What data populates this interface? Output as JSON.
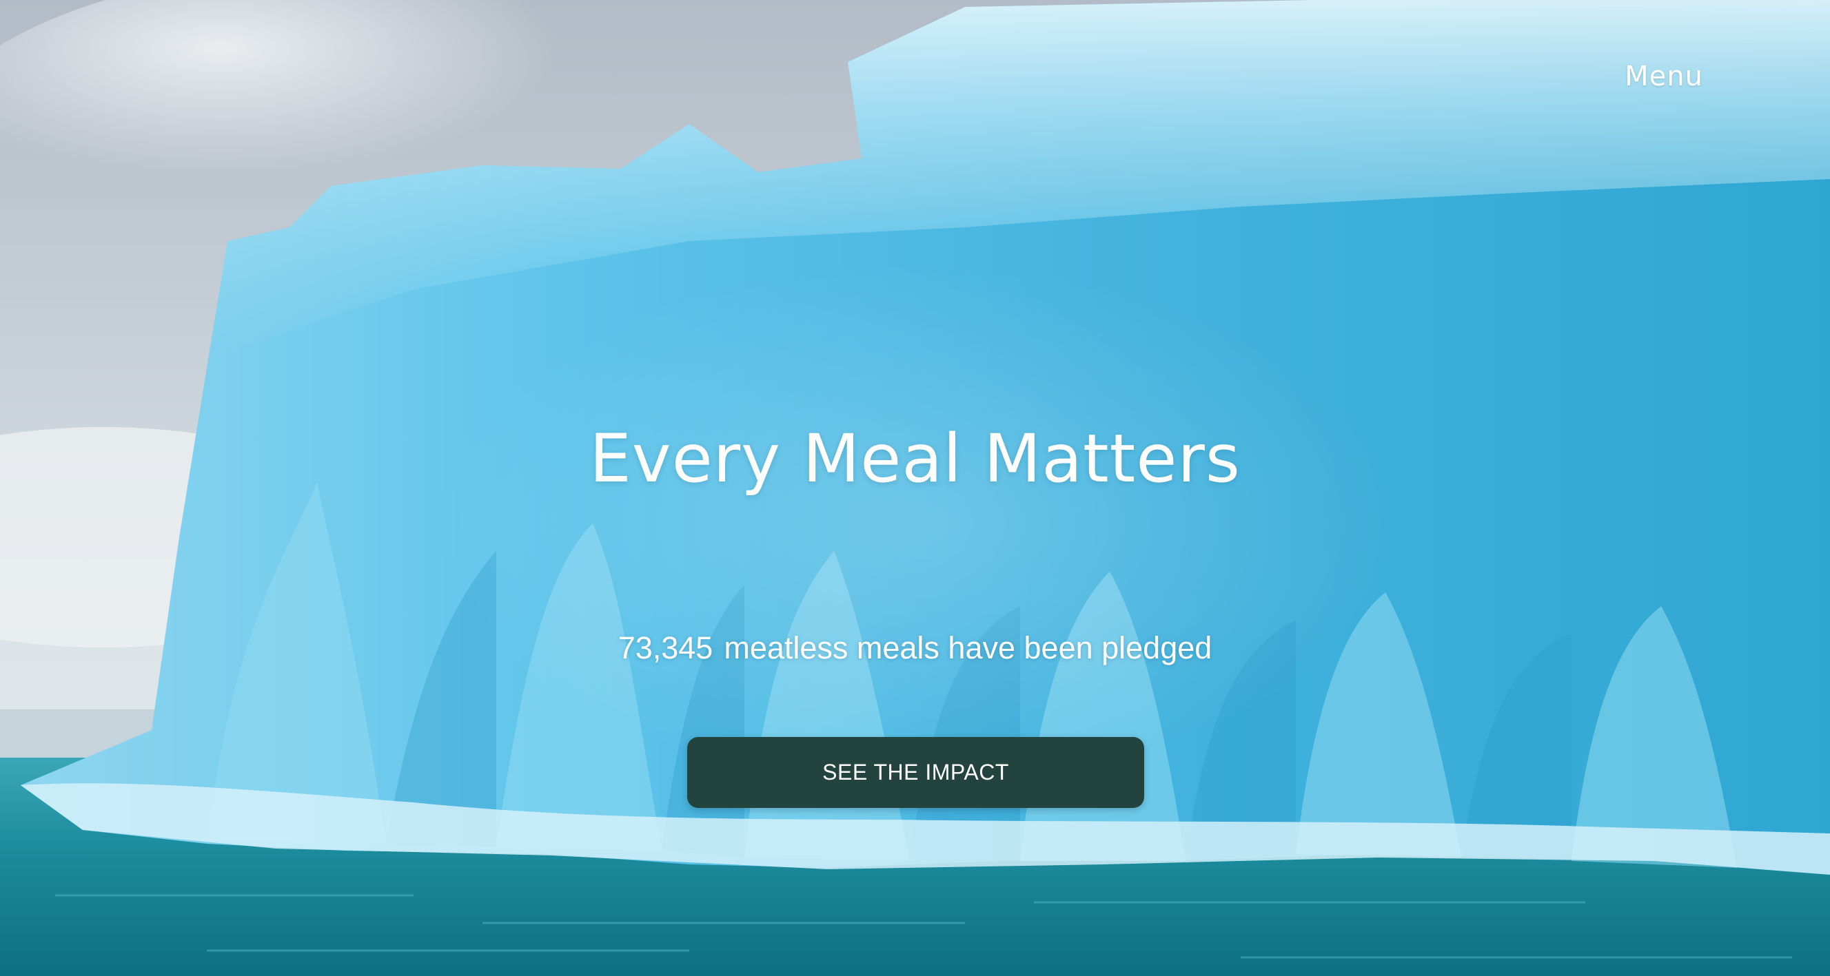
{
  "nav": {
    "menu_label": "Menu"
  },
  "hero": {
    "headline": "Every Meal Matters",
    "pledge_count": "73,345",
    "pledge_text": "meatless meals have been pledged",
    "cta_label": "SEE THE IMPACT",
    "background_image": "iceberg-photo"
  },
  "colors": {
    "cta_background": "#23433f",
    "text": "#ffffff",
    "sky": "#c9d3dc",
    "ice": "#5fc3e6",
    "water": "#1a8fa0"
  }
}
